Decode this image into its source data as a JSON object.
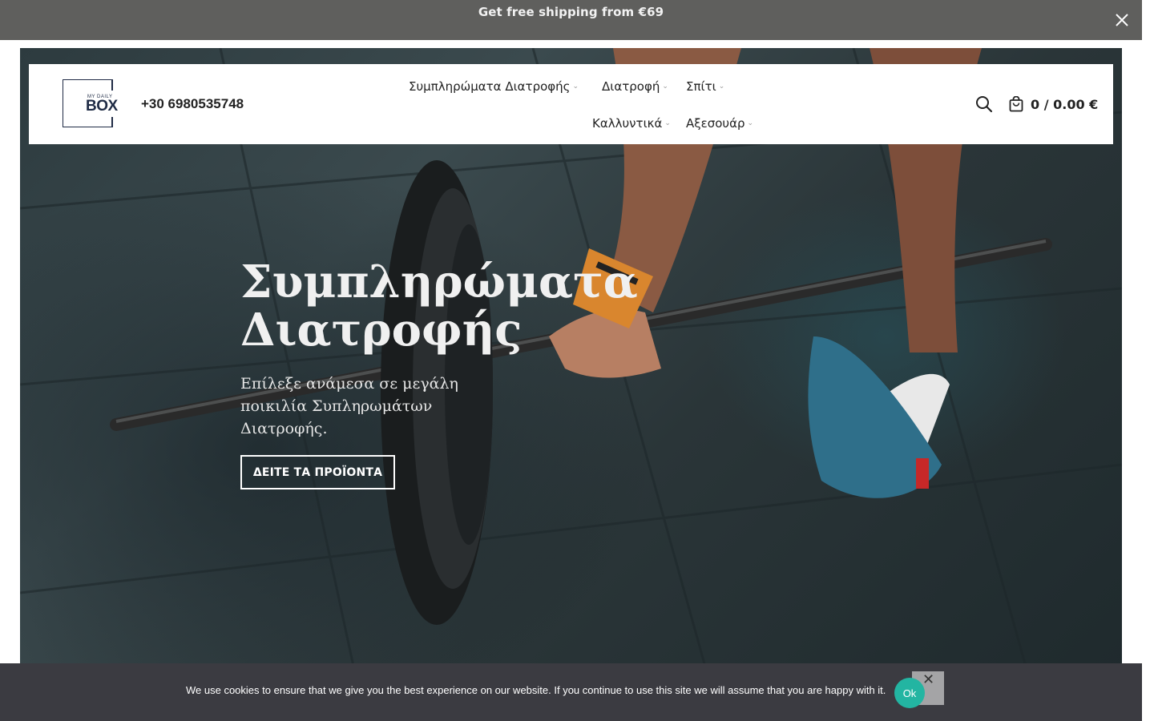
{
  "promo": {
    "text": "Get free shipping from €69",
    "close_icon": "close-icon"
  },
  "header": {
    "logo": {
      "top_text": "MY DAILY",
      "main_text": "BOX"
    },
    "phone": "+30 6980535748",
    "nav": [
      {
        "label": "Συμπληρώματα Διατροφής",
        "has_dropdown": true
      },
      {
        "label": "Διατροφή",
        "has_dropdown": true
      },
      {
        "label": "Σπίτι",
        "has_dropdown": true
      },
      {
        "label": "Καλλυντικά",
        "has_dropdown": true
      },
      {
        "label": "Αξεσουάρ",
        "has_dropdown": true
      }
    ],
    "search_icon": "search-icon",
    "cart": {
      "icon": "shopping-bag-icon",
      "text": "0 / 0.00 €"
    }
  },
  "hero": {
    "title_line1": "Συμπληρώματα",
    "title_line2": "Διατροφής",
    "subtitle": "Επίλεξε ανάμεσα σε μεγάλη ποικιλία Συπληρωμάτων Διατροφής.",
    "cta": "ΔΕΙΤΕ ΤΑ ΠΡΟΪΟΝΤΑ"
  },
  "cookie": {
    "text": "We use cookies to ensure that we give you the best experience on our website. If you continue to use this site we will assume that you are happy with it.",
    "ok_label": "Ok",
    "close_glyph": "✕"
  },
  "colors": {
    "promo_bg": "#5f5f5d",
    "cookie_bg": "#3b3b41",
    "ok_button": "#23b5a2",
    "logo": "#1f2b45"
  }
}
